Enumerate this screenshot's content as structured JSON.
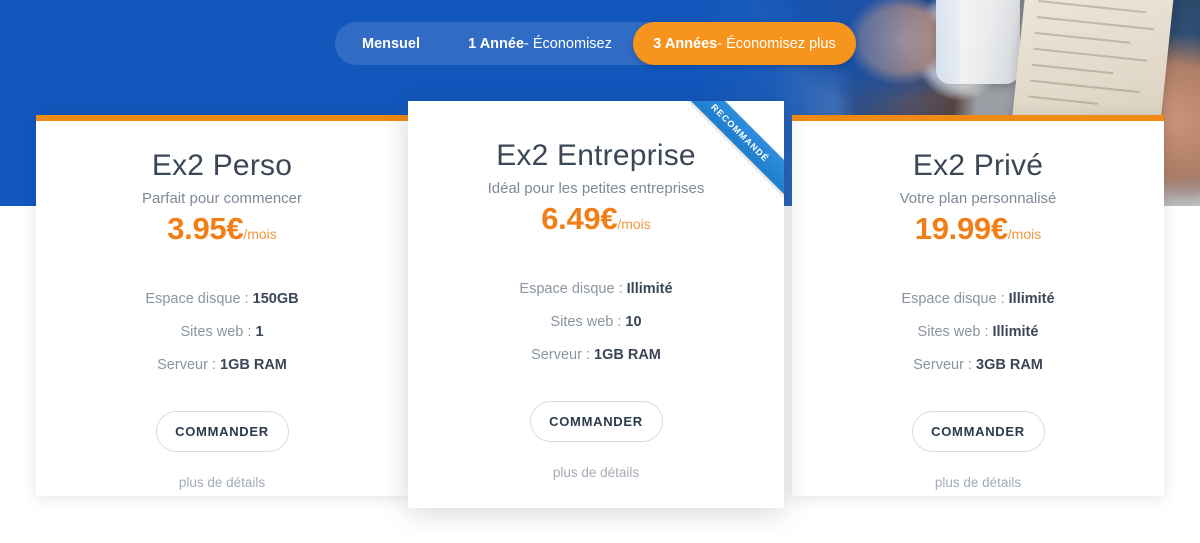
{
  "billing_toggle": {
    "name": "billing-period-toggle",
    "options": [
      {
        "strong": "Mensuel",
        "light": "",
        "selected": false
      },
      {
        "strong": "1 Année",
        "light": "- Économisez",
        "selected": false
      },
      {
        "strong": "3 Années",
        "light": "- Économisez plus",
        "selected": true
      }
    ]
  },
  "ribbon": {
    "label": "RECOMMANDÉ"
  },
  "plans": [
    {
      "id": "ex2-perso",
      "name": "Ex2 Perso",
      "tagline": "Parfait pour commencer",
      "price_amount": "3.95€",
      "price_period": "/mois",
      "features": [
        {
          "label": "Espace disque :",
          "value": "150GB"
        },
        {
          "label": "Sites web :",
          "value": "1"
        },
        {
          "label": "Serveur :",
          "value": "1GB RAM"
        }
      ],
      "cta": "COMMANDER",
      "details": "plus de détails",
      "featured": false
    },
    {
      "id": "ex2-entreprise",
      "name": "Ex2 Entreprise",
      "tagline": "Idéal pour les petites entreprises",
      "price_amount": "6.49€",
      "price_period": "/mois",
      "features": [
        {
          "label": "Espace disque :",
          "value": "Illimité"
        },
        {
          "label": "Sites web :",
          "value": "10"
        },
        {
          "label": "Serveur :",
          "value": "1GB RAM"
        }
      ],
      "cta": "COMMANDER",
      "details": "plus de détails",
      "featured": true
    },
    {
      "id": "ex2-prive",
      "name": "Ex2 Privé",
      "tagline": "Votre plan personnalisé",
      "price_amount": "19.99€",
      "price_period": "/mois",
      "features": [
        {
          "label": "Espace disque :",
          "value": "Illimité"
        },
        {
          "label": "Sites web :",
          "value": "Illimité"
        },
        {
          "label": "Serveur :",
          "value": "3GB RAM"
        }
      ],
      "cta": "COMMANDER",
      "details": "plus de détails",
      "featured": false
    }
  ],
  "colors": {
    "brand_blue": "#1257bc",
    "accent_orange": "#f7941e",
    "price_orange": "#f07f1a",
    "card_topbar": "#f18a12",
    "ribbon_blue": "#2e8ede",
    "heading_slate": "#3b4757",
    "muted_text": "#8a94a2"
  }
}
